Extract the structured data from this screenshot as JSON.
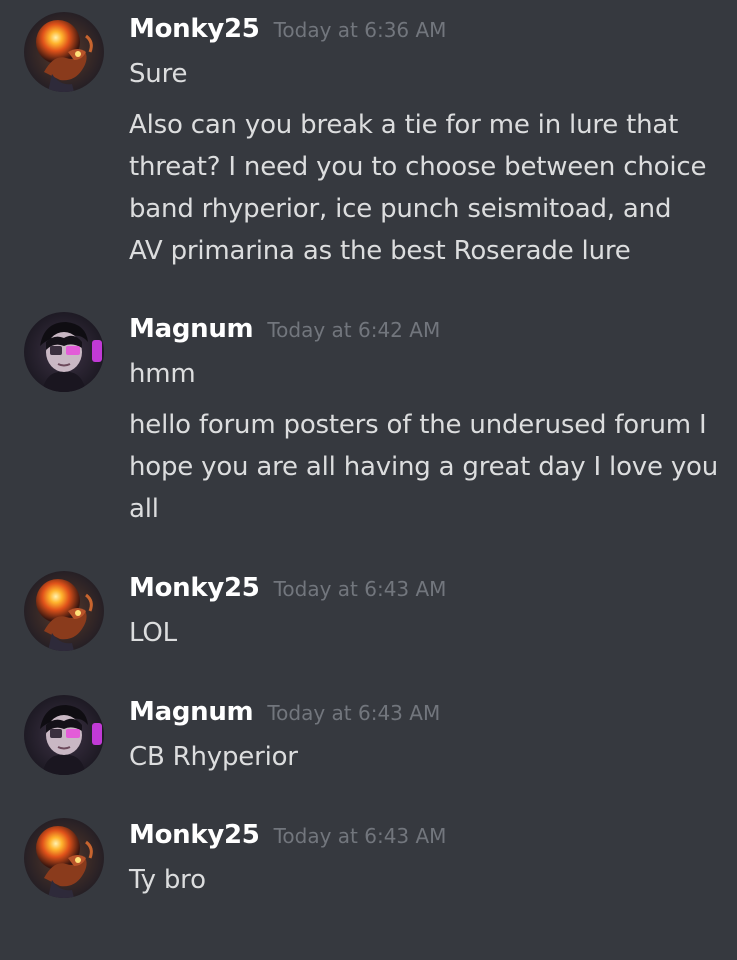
{
  "messages": [
    {
      "username": "Monky25",
      "timestamp": "Today at 6:36 AM",
      "avatar": "monky-avatar-icon",
      "lines": [
        "Sure",
        "Also can you break a tie for me in lure that",
        "threat? I need you to choose between choice",
        "band rhyperior, ice punch seismitoad, and",
        "AV primarina as the best Roserade lure"
      ]
    },
    {
      "username": "Magnum",
      "timestamp": "Today at 6:42 AM",
      "avatar": "magnum-avatar-icon",
      "lines": [
        "hmm",
        "hello forum posters of the underused forum I",
        "hope you are all having a great day I love you",
        "all"
      ]
    },
    {
      "username": "Monky25",
      "timestamp": "Today at 6:43 AM",
      "avatar": "monky-avatar-icon",
      "lines": [
        "LOL"
      ]
    },
    {
      "username": "Magnum",
      "timestamp": "Today at 6:43 AM",
      "avatar": "magnum-avatar-icon",
      "lines": [
        "CB Rhyperior"
      ]
    },
    {
      "username": "Monky25",
      "timestamp": "Today at 6:43 AM",
      "avatar": "monky-avatar-icon",
      "lines": [
        "Ty bro"
      ]
    }
  ],
  "colors": {
    "background": "#36393f",
    "username": "#ffffff",
    "timestamp": "#72767d",
    "text": "#dcddde"
  }
}
